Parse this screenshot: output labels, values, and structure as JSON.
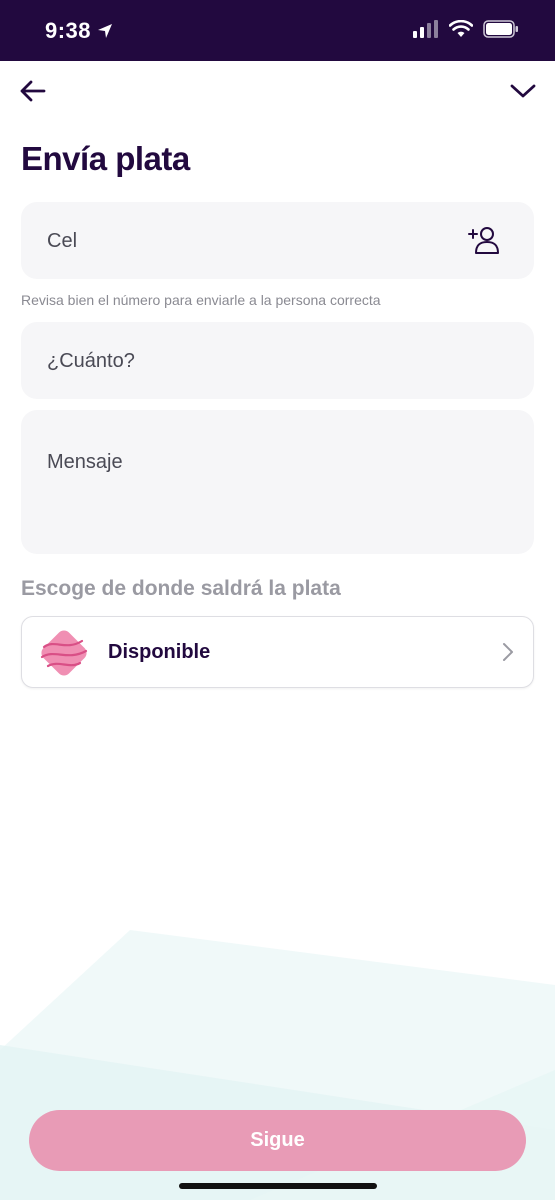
{
  "status_bar": {
    "time": "9:38"
  },
  "header": {
    "title": "Envía plata"
  },
  "form": {
    "phone_placeholder": "Cel",
    "phone_hint": "Revisa bien el número para enviarle a la persona correcta",
    "amount_placeholder": "¿Cuánto?",
    "message_placeholder": "Mensaje"
  },
  "source": {
    "section_label": "Escoge de donde saldrá la plata",
    "selected_label": "Disponible"
  },
  "actions": {
    "primary_label": "Sigue"
  },
  "colors": {
    "brand_dark": "#22093f",
    "button_pink": "#e89bb6",
    "field_bg": "#f6f6f8"
  }
}
